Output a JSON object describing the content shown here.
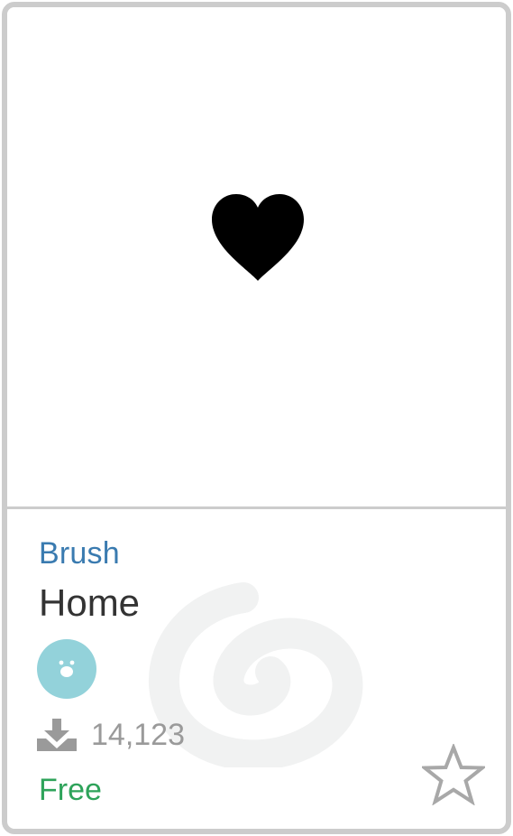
{
  "card": {
    "category": "Brush",
    "title": "Home",
    "downloads": "14,123",
    "price": "Free"
  },
  "preview": {
    "icon": "heart-icon"
  },
  "icons": {
    "download": "download-icon",
    "favorite": "star-outline-icon",
    "avatar": "avatar-face-icon",
    "watermark": "swirl-logo-watermark"
  },
  "colors": {
    "category": "#3a7bb0",
    "price": "#2ea35a",
    "avatar": "#93d2da",
    "border": "#cccccc"
  }
}
